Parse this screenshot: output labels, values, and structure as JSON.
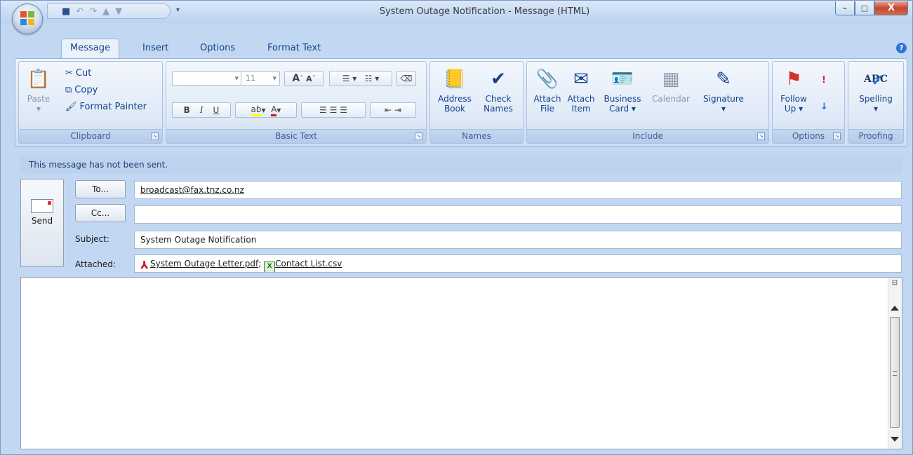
{
  "window": {
    "title": "System Outage Notification - Message (HTML)",
    "controls": {
      "minimize": "–",
      "maximize": "□",
      "close": "X"
    }
  },
  "tabs": [
    "Message",
    "Insert",
    "Options",
    "Format Text"
  ],
  "ribbon": {
    "clipboard": {
      "label": "Clipboard",
      "paste": "Paste",
      "cut": "Cut",
      "copy": "Copy",
      "format_painter": "Format Painter"
    },
    "basic_text": {
      "label": "Basic Text",
      "font_size": "11",
      "bold": "B",
      "italic": "I",
      "underline": "U"
    },
    "names": {
      "label": "Names",
      "address_book": [
        "Address",
        "Book"
      ],
      "check_names": [
        "Check",
        "Names"
      ]
    },
    "include": {
      "label": "Include",
      "attach_file": [
        "Attach",
        "File"
      ],
      "attach_item": [
        "Attach",
        "Item"
      ],
      "business_card": [
        "Business",
        "Card ▾"
      ],
      "calendar": "Calendar",
      "signature": "Signature"
    },
    "options": {
      "label": "Options",
      "follow_up": [
        "Follow",
        "Up ▾"
      ]
    },
    "proofing": {
      "label": "Proofing",
      "spelling": "Spelling",
      "abc": "ABC"
    }
  },
  "message": {
    "info": "This message has not been sent.",
    "send": "Send",
    "to_button": "To...",
    "cc_button": "Cc...",
    "to_value": "broadcast@fax.tnz.co.nz",
    "cc_value": "",
    "subject_label": "Subject:",
    "subject_value": "System Outage Notification",
    "attached_label": "Attached:",
    "attachments": [
      {
        "name": "System Outage Letter.pdf",
        "sep": ";"
      },
      {
        "name": "Contact List.csv",
        "sep": ""
      }
    ]
  },
  "colors": {
    "accent": "#15428b",
    "ribbon_bg": "#dbe7f6",
    "frame": "#c2d8f2"
  }
}
